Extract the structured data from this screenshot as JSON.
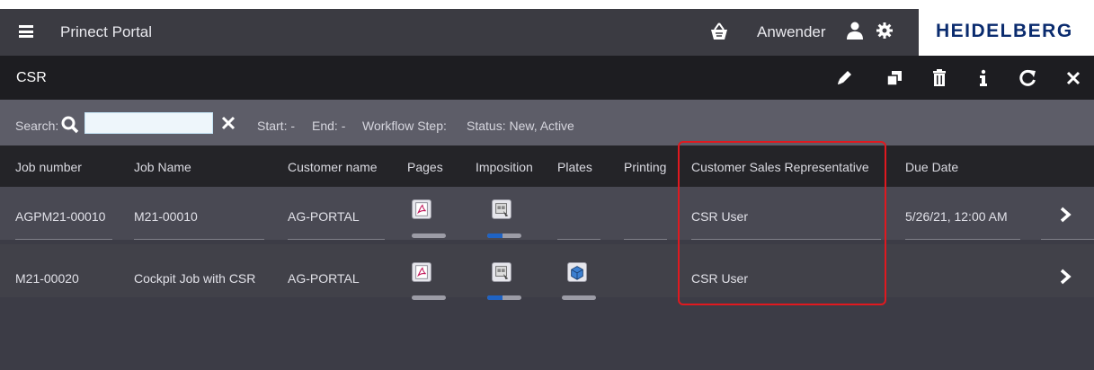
{
  "topbar": {
    "app_title": "Prinect Portal",
    "user_label": "Anwender",
    "brand": "HEIDELBERG"
  },
  "csrbar": {
    "title": "CSR"
  },
  "filter": {
    "search_label": "Search:",
    "search_value": "",
    "start": "Start: -",
    "end": "End: -",
    "workflow_step": "Workflow Step:",
    "status": "Status: New, Active"
  },
  "columns": {
    "job_number": "Job number",
    "job_name": "Job Name",
    "customer_name": "Customer name",
    "pages": "Pages",
    "imposition": "Imposition",
    "plates": "Plates",
    "printing": "Printing",
    "csr": "Customer Sales Representative",
    "due_date": "Due Date"
  },
  "rows": [
    {
      "job_number": "AGPM21-00010",
      "job_name": "M21-00010",
      "customer_name": "AG-PORTAL",
      "csr": "CSR User",
      "due_date": "5/26/21, 12:00 AM",
      "pages_progress": 0,
      "imposition_progress": 0.45
    },
    {
      "job_number": "M21-00020",
      "job_name": "Cockpit Job with CSR",
      "customer_name": "AG-PORTAL",
      "csr": "CSR User",
      "due_date": "",
      "pages_progress": 0,
      "imposition_progress": 0.45,
      "plates_progress": 0
    }
  ],
  "colors": {
    "highlight": "#e0191f",
    "progress": "#1f63c4",
    "brand": "#0a2b6e"
  }
}
